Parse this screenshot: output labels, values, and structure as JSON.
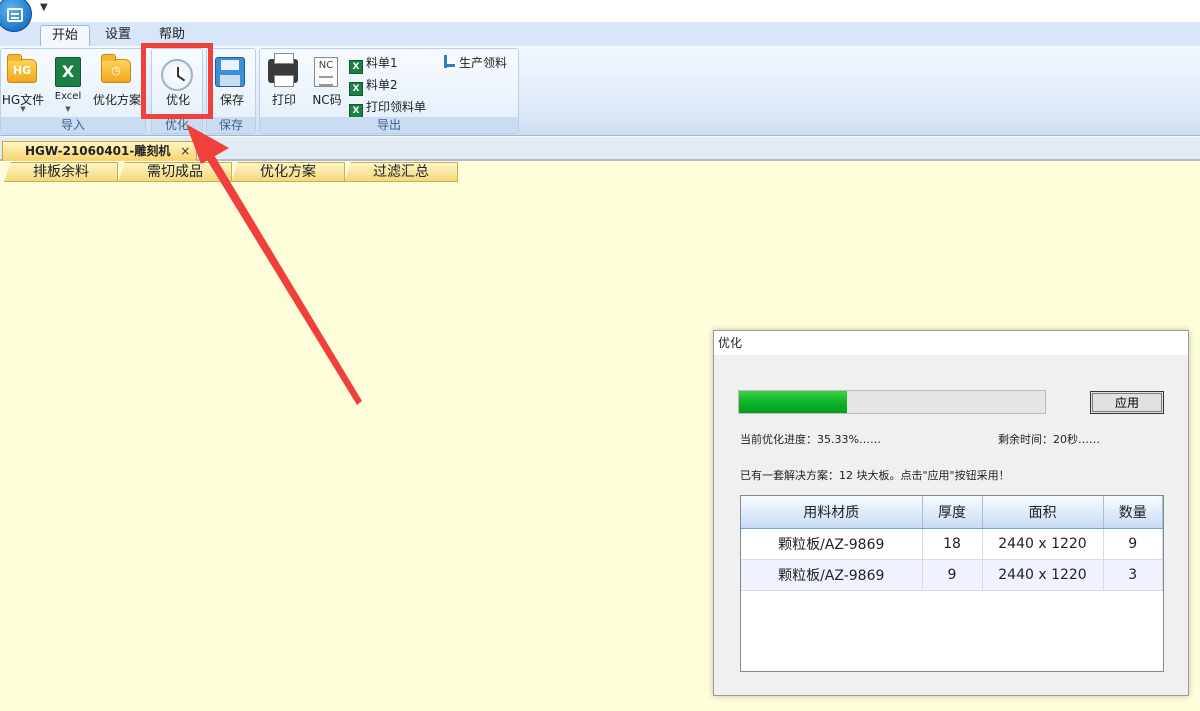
{
  "ribbon": {
    "tabs": [
      {
        "label": "开始",
        "active": true
      },
      {
        "label": "设置",
        "active": false
      },
      {
        "label": "帮助",
        "active": false
      }
    ],
    "groups": {
      "import": {
        "label": "导入",
        "hg_file": "HG文件",
        "hg_icon_text": "HG",
        "excel": "Excel",
        "excel_icon_text": "X",
        "plan": "优化方案"
      },
      "optimize": {
        "label": "优化",
        "button": "优化"
      },
      "save": {
        "label": "保存",
        "button": "保存"
      },
      "export": {
        "label": "导出",
        "print": "打印",
        "nc_code": "NC码",
        "nc_icon_text": "NC",
        "list1": "料单1",
        "list2": "料单2",
        "print_list": "打印领料单",
        "production": "生产领料"
      }
    }
  },
  "document": {
    "tab_title": "HGW-21060401-雕刻机",
    "close_glyph": "×",
    "subtabs": [
      "排板余料",
      "需切成品",
      "优化方案",
      "过滤汇总"
    ]
  },
  "dialog": {
    "title": "优化",
    "progress_percent": 35.33,
    "progress_text": "当前优化进度：35.33%……",
    "remaining_text": "剩余时间：20秒……",
    "apply_label": "应用",
    "solution_text": "已有一套解决方案：12 块大板。点击\"应用\"按钮采用！",
    "table": {
      "headers": [
        "用料材质",
        "厚度",
        "面积",
        "数量"
      ],
      "rows": [
        [
          "颗粒板/AZ-9869",
          "18",
          "2440 x 1220",
          "9"
        ],
        [
          "颗粒板/AZ-9869",
          "9",
          "2440 x 1220",
          "3"
        ]
      ]
    }
  },
  "colors": {
    "progress_fill": "#06b025",
    "highlight": "#f0403c",
    "background": "#fffedb"
  }
}
